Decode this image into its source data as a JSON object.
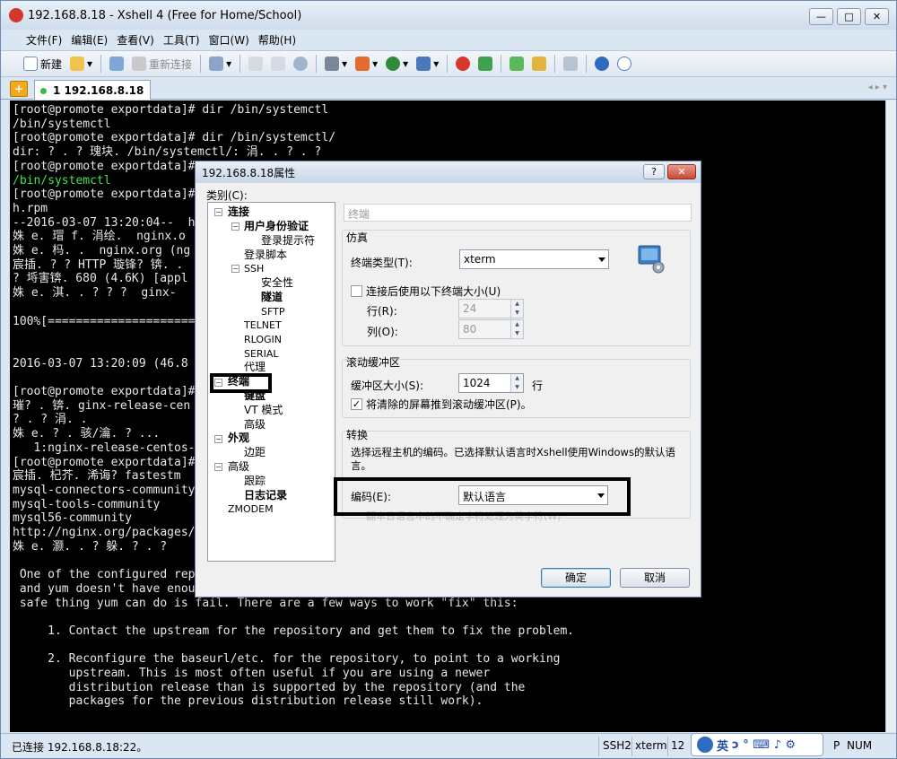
{
  "window": {
    "title": "192.168.8.18 - Xshell 4 (Free for Home/School)",
    "min": "—",
    "max": "□",
    "close": "✕"
  },
  "menu": [
    "文件(F)",
    "编辑(E)",
    "查看(V)",
    "工具(T)",
    "窗口(W)",
    "帮助(H)"
  ],
  "toolbar": {
    "new_label": "新建",
    "reconnect_label": "重新连接"
  },
  "tab": {
    "add": "+",
    "label": "1 192.168.8.18",
    "nav": "◂ ▸ ▾"
  },
  "terminal_lines": [
    {
      "text": "[root@promote exportdata]# dir /bin/systemctl",
      "color": "white"
    },
    {
      "text": "/bin/systemctl",
      "color": "white"
    },
    {
      "text": "[root@promote exportdata]# dir /bin/systemctl/",
      "color": "white"
    },
    {
      "text": "dir: ? . ? 瑰块. /bin/systemctl/: 涓. . ? . ?",
      "color": "white"
    },
    {
      "text": "[root@promote exportdata]#",
      "color": "white"
    },
    {
      "text": "/bin/systemctl",
      "color": "green"
    },
    {
      "text": "[root@promote exportdata]#                                              os-7-0.el7.ngx.noarc",
      "color": "white"
    },
    {
      "text": "h.rpm",
      "color": "white"
    },
    {
      "text": "--2016-03-07 13:20:04--  h                                              el7.ngx.noarch.rpm",
      "color": "white"
    },
    {
      "text": "姝 e. 瑁 f. 涓绘.  nginx.o                                                :e3, ...",
      "color": "white"
    },
    {
      "text": "姝 e. 杩. .  nginx.org (ng",
      "color": "white"
    },
    {
      "text": "宸插. ? ? HTTP 璇锋? 锛. .",
      "color": "white"
    },
    {
      "text": "? 埓害锛. 680 (4.6K) [appl",
      "color": "white"
    },
    {
      "text": "姝 e. 淇. . ? ? ?  ginx-",
      "color": "white"
    },
    {
      "text": "",
      "color": "white"
    },
    {
      "text": "100%[=====================                                              .-K/s ? 儿.  0s",
      "color": "white"
    },
    {
      "text": "",
      "color": "white"
    },
    {
      "text": "",
      "color": "white"
    },
    {
      "text": "2016-03-07 13:20:09 (46.8                                               0/4680])",
      "color": "white"
    },
    {
      "text": "",
      "color": "white"
    },
    {
      "text": "[root@promote exportdata]#",
      "color": "white"
    },
    {
      "text": "璀? . 锛. ginx-release-cen                                               : NOKEY",
      "color": "white"
    },
    {
      "text": "? . ? 涓. .",
      "color": "white"
    },
    {
      "text": "姝 e. ? . 骇/瀹. ? ...",
      "color": "white"
    },
    {
      "text": "   1:nginx-release-centos-",
      "color": "white"
    },
    {
      "text": "[root@promote exportdata]#",
      "color": "white"
    },
    {
      "text": "宸插. 杞芥. 浠诲? fastestm",
      "color": "white"
    },
    {
      "text": "mysql-connectors-community                                              .5 kB  00:00:00",
      "color": "white"
    },
    {
      "text": "mysql-tools-community                                                   .5 kB  00:00:00",
      "color": "white"
    },
    {
      "text": "mysql56-community                                                       .5 kB  00:00:00",
      "color": "white"
    },
    {
      "text": "http://nginx.org/packages/                                              eway",
      "color": "white"
    },
    {
      "text": "姝 e. 灏. . ? 躲. ? . ?",
      "color": "white"
    },
    {
      "text": "",
      "color": "white"
    },
    {
      "text": " One of the configured rep",
      "color": "white"
    },
    {
      "text": " and yum doesn't have enough cached data to continue. At this point the only",
      "color": "white"
    },
    {
      "text": " safe thing yum can do is fail. There are a few ways to work \"fix\" this:",
      "color": "white"
    },
    {
      "text": "",
      "color": "white"
    },
    {
      "text": "     1. Contact the upstream for the repository and get them to fix the problem.",
      "color": "white"
    },
    {
      "text": "",
      "color": "white"
    },
    {
      "text": "     2. Reconfigure the baseurl/etc. for the repository, to point to a working",
      "color": "white"
    },
    {
      "text": "        upstream. This is most often useful if you are using a newer",
      "color": "white"
    },
    {
      "text": "        distribution release than is supported by the repository (and the",
      "color": "white"
    },
    {
      "text": "        packages for the previous distribution release still work).",
      "color": "white"
    }
  ],
  "status": {
    "connection": "已连接 192.168.8.18:22。",
    "ssh": "SSH2",
    "term": "xterm",
    "size": "12",
    "cap": "P",
    "num": "NUM"
  },
  "ime": {
    "label": "英",
    "chars": "ɔ ° ⌨ ♪ ⚙"
  },
  "dialog": {
    "title": "192.168.8.18属性",
    "help": "?",
    "close": "✕",
    "category_label": "类别(C):",
    "tree": {
      "connection": "连接",
      "auth": "用户身份验证",
      "login_prompt": "登录提示符",
      "login_script": "登录脚本",
      "ssh": "SSH",
      "security": "安全性",
      "tunnel": "隧道",
      "sftp": "SFTP",
      "telnet": "TELNET",
      "rlogin": "RLOGIN",
      "serial": "SERIAL",
      "proxy": "代理",
      "terminal": "终端",
      "keyboard": "键盘",
      "vt_mode": "VT 模式",
      "advanced_term": "高级",
      "appearance": "外观",
      "margin": "边距",
      "advanced": "高级",
      "trace": "跟踪",
      "log": "日志记录",
      "zmodem": "ZMODEM"
    },
    "pane_title": "终端",
    "emulation": {
      "group": "仿真",
      "term_type_label": "终端类型(T):",
      "term_type_value": "xterm",
      "use_size_label": "连接后使用以下终端大小(U)",
      "rows_label": "行(R):",
      "rows_value": "24",
      "cols_label": "列(O):",
      "cols_value": "80"
    },
    "scrollback": {
      "group": "滚动缓冲区",
      "size_label": "缓冲区大小(S):",
      "size_value": "1024",
      "unit": "行",
      "push_label": "将清除的屏幕推到滚动缓冲区(P)。"
    },
    "conversion": {
      "group": "转换",
      "desc": "选择远程主机的编码。已选择默认语言时Xshell使用Windows的默认语言。",
      "encoding_label": "编码(E):",
      "encoding_value": "默认语言",
      "hidden_option": "翻本日语言中的不确定字符处理为英字符(W)"
    },
    "ok": "确定",
    "cancel": "取消"
  }
}
